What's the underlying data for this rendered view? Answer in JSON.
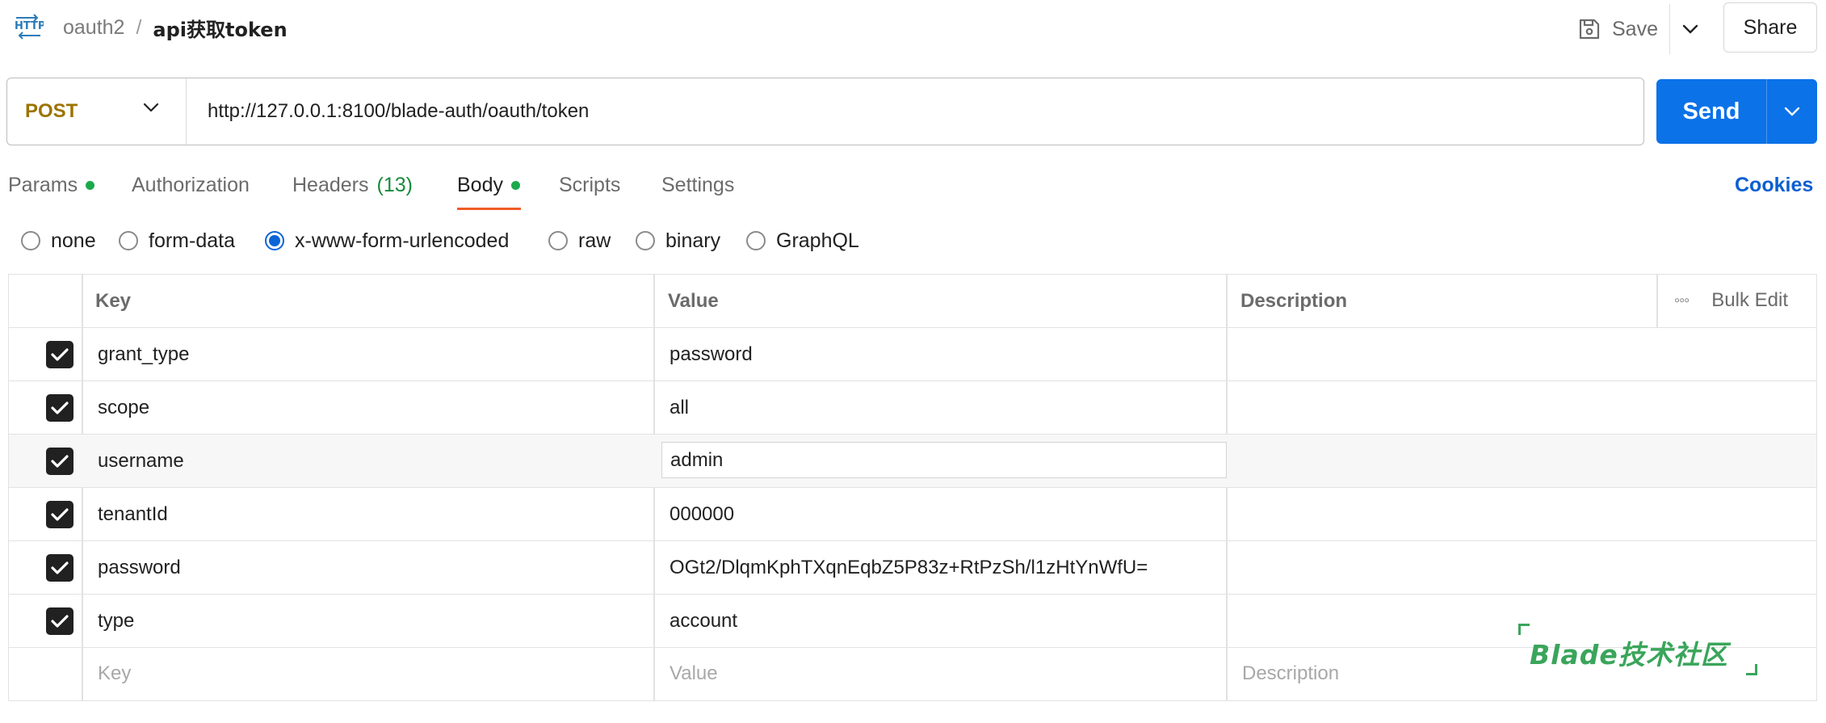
{
  "header": {
    "icon": "http-icon",
    "breadcrumb_parent": "oauth2",
    "breadcrumb_separator": "/",
    "request_name": "api获取token",
    "save_label": "Save",
    "share_label": "Share"
  },
  "request": {
    "method": "POST",
    "method_color": "#9c7300",
    "url": "http://127.0.0.1:8100/blade-auth/oauth/token",
    "send_label": "Send",
    "send_color": "#0b72e8"
  },
  "tabs": [
    {
      "label": "Params",
      "indicator": "dot"
    },
    {
      "label": "Authorization"
    },
    {
      "label": "Headers",
      "count": "(13)"
    },
    {
      "label": "Body",
      "indicator": "dot",
      "active": true
    },
    {
      "label": "Scripts"
    },
    {
      "label": "Settings"
    }
  ],
  "cookies_label": "Cookies",
  "body_types": [
    {
      "label": "none",
      "selected": false
    },
    {
      "label": "form-data",
      "selected": false
    },
    {
      "label": "x-www-form-urlencoded",
      "selected": true
    },
    {
      "label": "raw",
      "selected": false
    },
    {
      "label": "binary",
      "selected": false
    },
    {
      "label": "GraphQL",
      "selected": false
    }
  ],
  "table": {
    "columns": {
      "key": "Key",
      "value": "Value",
      "description": "Description"
    },
    "bulk_edit_label": "Bulk Edit",
    "rows": [
      {
        "checked": true,
        "key": "grant_type",
        "value": "password",
        "description": ""
      },
      {
        "checked": true,
        "key": "scope",
        "value": "all",
        "description": ""
      },
      {
        "checked": true,
        "key": "username",
        "value": "admin",
        "description": ""
      },
      {
        "checked": true,
        "key": "tenantId",
        "value": "000000",
        "description": ""
      },
      {
        "checked": true,
        "key": "password",
        "value": "OGt2/DlqmKphTXqnEqbZ5P83z+RtPzSh/l1zHtYnWfU=",
        "description": ""
      },
      {
        "checked": true,
        "key": "type",
        "value": "account",
        "description": ""
      }
    ],
    "placeholders": {
      "key": "Key",
      "value": "Value",
      "description": "Description"
    }
  },
  "watermark": {
    "text": "Blade技术社区",
    "color": "#3aa55b"
  }
}
